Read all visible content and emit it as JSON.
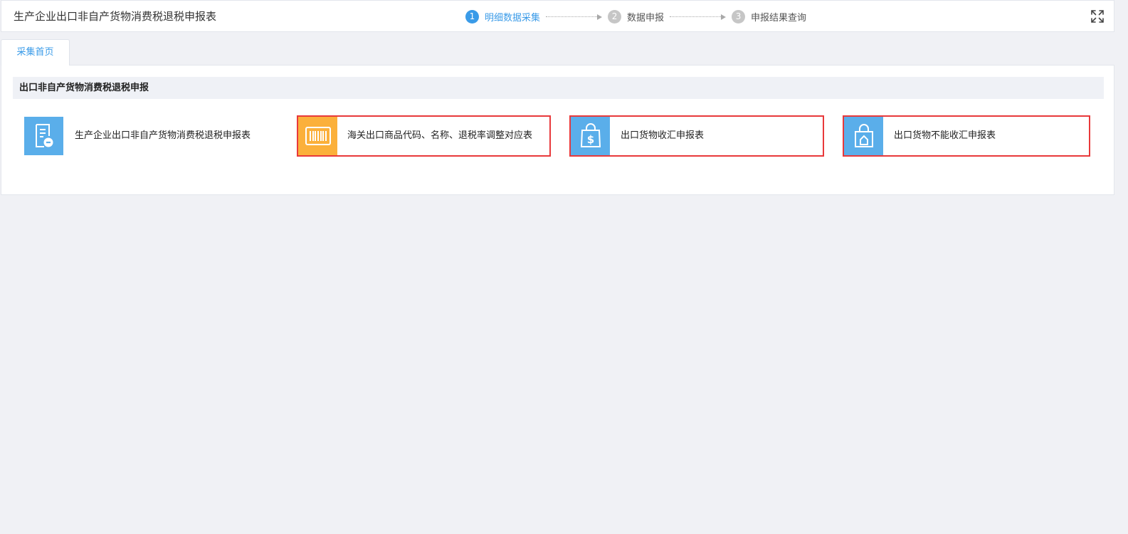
{
  "header": {
    "title": "生产企业出口非自产货物消费税退税申报表",
    "steps": [
      {
        "number": "1",
        "label": "明细数据采集",
        "active": true
      },
      {
        "number": "2",
        "label": "数据申报",
        "active": false
      },
      {
        "number": "3",
        "label": "申报结果查询",
        "active": false
      }
    ],
    "fullscreen_icon": "expand-icon"
  },
  "tabs": [
    {
      "label": "采集首页",
      "active": true
    }
  ],
  "section": {
    "title": "出口非自产货物消费税退税申报"
  },
  "cards": [
    {
      "label": "生产企业出口非自产货物消费税退税申报表",
      "icon": "document-icon",
      "icon_bg": "#5aaeea",
      "highlighted": false
    },
    {
      "label": "海关出口商品代码、名称、退税率调整对应表",
      "icon": "barcode-icon",
      "icon_bg": "#fbb03b",
      "highlighted": true
    },
    {
      "label": "出口货物收汇申报表",
      "icon": "money-bag-icon",
      "icon_bg": "#5aaeea",
      "highlighted": true
    },
    {
      "label": "出口货物不能收汇申报表",
      "icon": "locked-bag-icon",
      "icon_bg": "#5aaeea",
      "highlighted": true
    }
  ],
  "colors": {
    "accent": "#3a9be8",
    "highlight_border": "#e8393b",
    "page_bg": "#f0f1f5"
  }
}
